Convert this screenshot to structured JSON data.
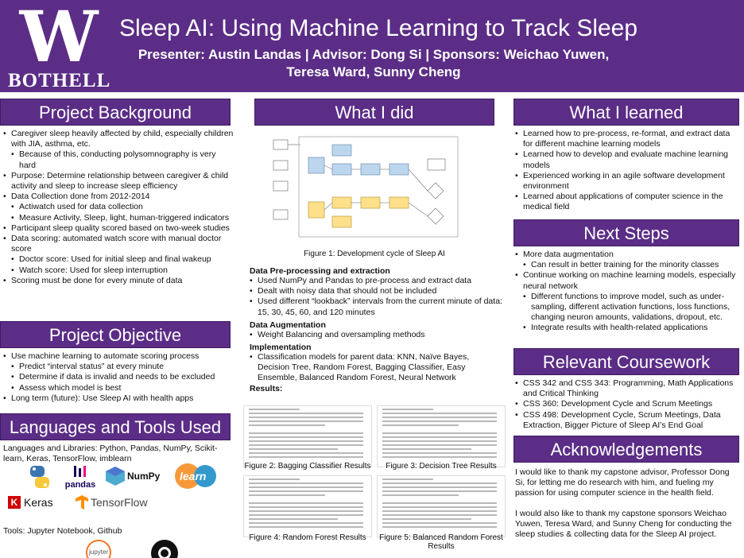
{
  "header": {
    "logo_mark": "W",
    "logo_text": "BOTHELL",
    "title": "Sleep AI: Using Machine Learning to Track Sleep",
    "subtitle": "Presenter: Austin Landas | Advisor: Dong Si | Sponsors: Weichao Yuwen, Teresa Ward, Sunny Cheng"
  },
  "background": {
    "heading": "Project Background",
    "items": [
      {
        "level": 1,
        "text": "Caregiver sleep heavily affected by child, especially children with JIA, asthma, etc."
      },
      {
        "level": 2,
        "text": "Because of this, conducting polysomnography is very hard"
      },
      {
        "level": 1,
        "text": "Purpose: Determine relationship between caregiver & child activity and sleep to increase sleep efficiency"
      },
      {
        "level": 1,
        "text": "Data Collection done from 2012-2014"
      },
      {
        "level": 2,
        "text": "Actiwatch used for data collection"
      },
      {
        "level": 2,
        "text": "Measure Activity, Sleep, light, human-triggered indicators"
      },
      {
        "level": 1,
        "text": "Participant sleep quality scored based on two-week studies"
      },
      {
        "level": 1,
        "text": "Data scoring: automated watch score with manual doctor score"
      },
      {
        "level": 2,
        "text": "Doctor score: Used for initial sleep and final wakeup"
      },
      {
        "level": 2,
        "text": "Watch score: Used for sleep interruption"
      },
      {
        "level": 1,
        "text": "Scoring must be done for every minute of data"
      }
    ]
  },
  "objective": {
    "heading": "Project Objective",
    "items": [
      {
        "level": 1,
        "text": "Use machine learning to automate scoring process"
      },
      {
        "level": 2,
        "text": "Predict “interval status” at every minute"
      },
      {
        "level": 2,
        "text": "Determine if data is invalid and needs to be excluded"
      },
      {
        "level": 2,
        "text": "Assess which model is best"
      },
      {
        "level": 1,
        "text": "Long term (future): Use Sleep AI with health apps"
      }
    ]
  },
  "tools": {
    "heading": "Languages and Tools Used",
    "libraries": "Languages and Libraries: Python, Pandas, NumPy, Scikit-learn, Keras, TensorFlow, imblearn",
    "logo_pandas": "pandas",
    "logo_numpy": "NumPy",
    "logo_sklearn": "learn",
    "logo_keras": "Keras",
    "logo_tensorflow": "TensorFlow",
    "tools_line": "Tools: Jupyter Notebook, Github",
    "logo_jupyter": "jupyter"
  },
  "whatidid": {
    "heading": "What I did",
    "fig1_caption": "Figure 1: Development cycle of Sleep AI",
    "preprocess_heading": "Data Pre-processing and extraction",
    "preprocess_items": [
      "Used NumPy and Pandas to pre-process and extract data",
      "Dealt with noisy data that should not be included",
      "Used different “lookback” intervals from the current minute of data: 15, 30, 45, 60, and 120 minutes"
    ],
    "augmentation_heading": "Data Augmentation",
    "augmentation_items": [
      "Weight Balancing and oversampling methods"
    ],
    "implementation_heading": "Implementation",
    "implementation_items": [
      "Classification models for parent data: KNN, Naïve Bayes, Decision Tree, Random Forest, Bagging Classifier, Easy Ensemble, Balanced Random Forest, Neural Network"
    ],
    "results_heading": "Results:",
    "fig2_caption": "Figure 2: Bagging Classifier Results",
    "fig3_caption": "Figure 3: Decision Tree Results",
    "fig4_caption": "Figure 4: Random Forest Results",
    "fig5_caption": "Figure 5: Balanced Random Forest Results"
  },
  "learned": {
    "heading": "What I learned",
    "items": [
      "Learned how to pre-process, re-format, and extract data for different machine learning models",
      "Learned how to develop and evaluate machine learning models",
      "Experienced working in an agile software development environment",
      "Learned about applications of computer science in the medical field"
    ]
  },
  "nextsteps": {
    "heading": "Next Steps",
    "items": [
      {
        "level": 1,
        "text": "More data augmentation"
      },
      {
        "level": 2,
        "text": "Can result in better training for the minority classes"
      },
      {
        "level": 1,
        "text": "Continue working on machine learning models, especially neural network"
      },
      {
        "level": 2,
        "text": "Different functions to improve model, such as under-sampling, different activation functions, loss functions, changing neuron amounts, validations, dropout, etc."
      },
      {
        "level": 2,
        "text": "Integrate results with health-related applications"
      }
    ]
  },
  "coursework": {
    "heading": "Relevant Coursework",
    "items": [
      "CSS 342 and CSS 343: Programming, Math Applications and Critical Thinking",
      "CSS 360: Development Cycle and Scrum Meetings",
      "CSS 498: Development Cycle, Scrum Meetings, Data Extraction, Bigger Picture of Sleep AI’s End Goal"
    ]
  },
  "acknowledgements": {
    "heading": "Acknowledgements",
    "para1": "I would like to thank my capstone advisor, Professor Dong Si, for letting me do research with him, and fueling my passion for using computer science in the health field.",
    "para2": "I would also like to thank my capstone sponsors Weichao Yuwen, Teresa Ward, and Sunny Cheng for conducting the sleep studies & collecting data for the Sleep AI project."
  },
  "colors": {
    "purple": "#5b2d86",
    "flow_blue": "#bcd6ee",
    "flow_yellow": "#ffe08a"
  }
}
